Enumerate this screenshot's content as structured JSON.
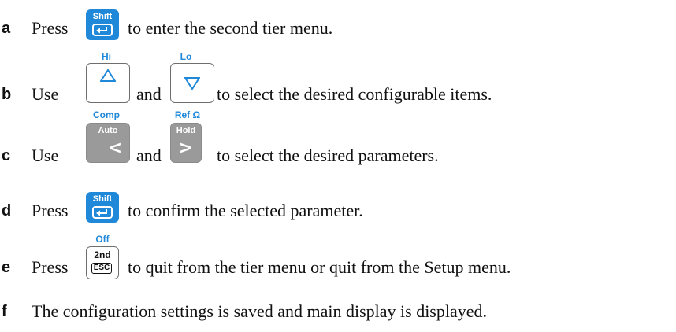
{
  "steps": [
    {
      "letter": "a",
      "prefix": "Press",
      "suffix": "to enter the second tier menu.",
      "key": {
        "top_label": "Shift",
        "icon": "enter-icon"
      }
    },
    {
      "letter": "b",
      "prefix": "Use",
      "mid": "and",
      "suffix": "to select the desired configurable items.",
      "key1": {
        "above": "Hi",
        "icon": "up-triangle-icon"
      },
      "key2": {
        "above": "Lo",
        "icon": "down-triangle-icon"
      }
    },
    {
      "letter": "c",
      "prefix": "Use",
      "mid": "and",
      "suffix": "to select the desired parameters.",
      "key1": {
        "above": "Comp",
        "top_label": "Auto",
        "glyph": "<"
      },
      "key2": {
        "above": "Ref Ω",
        "top_label": "Hold",
        "glyph": ">"
      }
    },
    {
      "letter": "d",
      "prefix": "Press",
      "suffix": "to confirm the selected parameter.",
      "key": {
        "top_label": "Shift",
        "icon": "enter-icon"
      }
    },
    {
      "letter": "e",
      "prefix": "Press",
      "suffix": "to quit from the tier menu or quit from the Setup menu.",
      "key": {
        "above": "Off",
        "top_label": "2nd",
        "bottom_label": "ESC"
      }
    },
    {
      "letter": "f",
      "text": "The configuration settings is saved and main display is displayed."
    }
  ],
  "colors": {
    "accent": "#1f88d8",
    "key_grey": "#9a9a9a",
    "border": "#6e6e6e"
  }
}
